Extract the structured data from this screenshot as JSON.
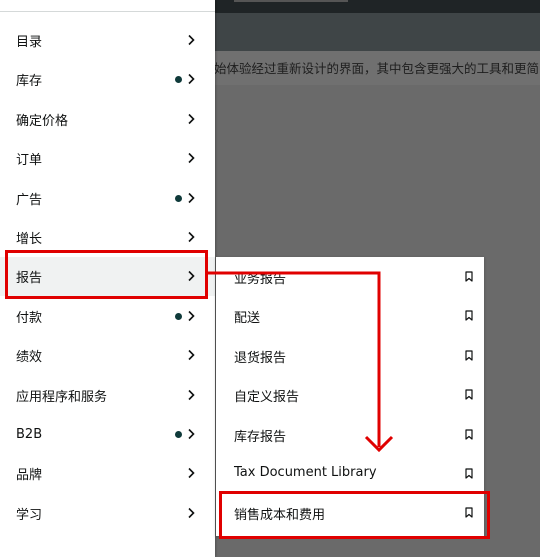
{
  "banner_text": "始体验经过重新设计的界面，其中包含更强大的工具和更简",
  "sidebar": {
    "items": [
      {
        "label": "目录",
        "dot": false
      },
      {
        "label": "库存",
        "dot": true
      },
      {
        "label": "确定价格",
        "dot": false
      },
      {
        "label": "订单",
        "dot": false
      },
      {
        "label": "广告",
        "dot": true
      },
      {
        "label": "增长",
        "dot": false
      },
      {
        "label": "报告",
        "dot": false
      },
      {
        "label": "付款",
        "dot": true
      },
      {
        "label": "绩效",
        "dot": false
      },
      {
        "label": "应用程序和服务",
        "dot": false
      },
      {
        "label": "B2B",
        "dot": true
      },
      {
        "label": "品牌",
        "dot": false
      },
      {
        "label": "学习",
        "dot": false
      }
    ]
  },
  "submenu": {
    "items": [
      {
        "label": "业务报告"
      },
      {
        "label": "配送"
      },
      {
        "label": "退货报告"
      },
      {
        "label": "自定义报告"
      },
      {
        "label": "库存报告"
      },
      {
        "label": "Tax Document Library"
      },
      {
        "label": "销售成本和费用"
      }
    ]
  },
  "colors": {
    "highlight": "#e00000",
    "dot": "#0f3a3a",
    "text": "#0f1111"
  },
  "icons": {
    "chevron": "chevron-right-icon",
    "pin": "bookmark-icon",
    "status": "notification-dot-icon"
  }
}
